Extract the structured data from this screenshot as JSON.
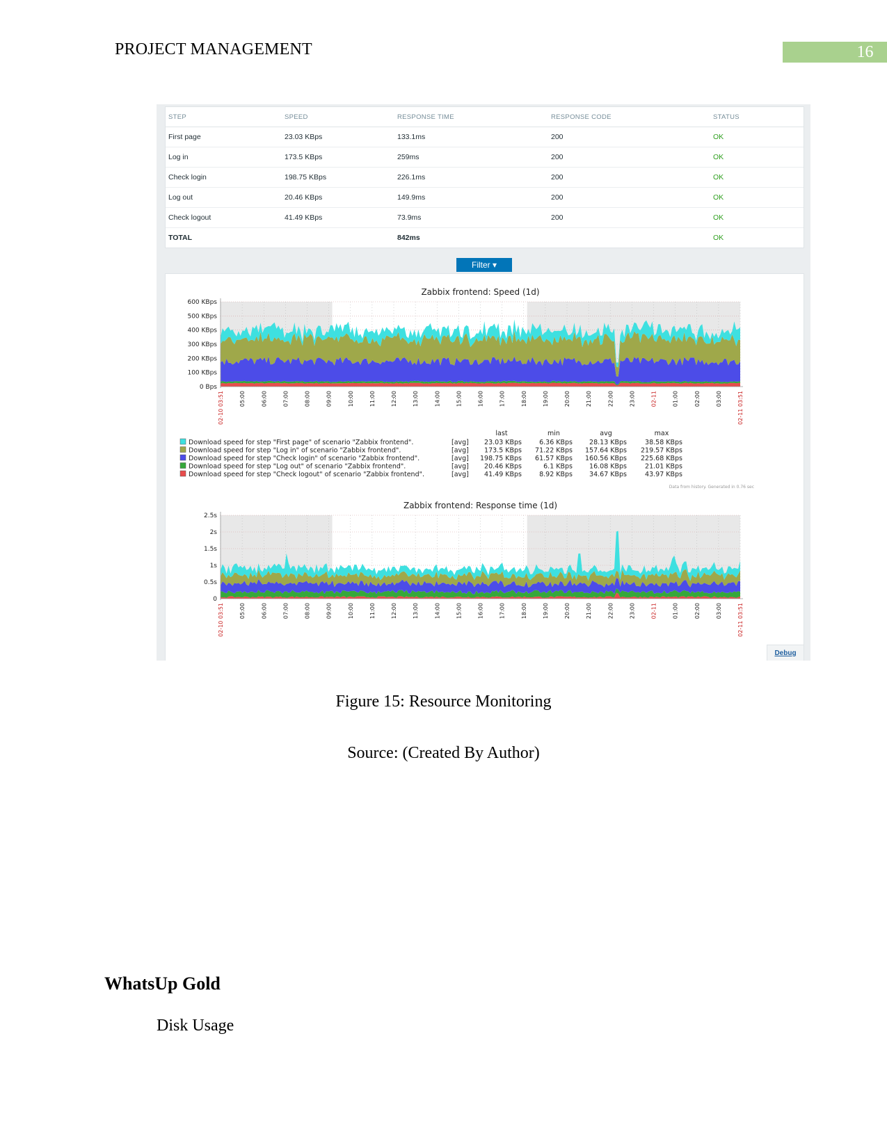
{
  "header": {
    "title": "PROJECT MANAGEMENT",
    "page_number": "16"
  },
  "table": {
    "columns": [
      "STEP",
      "SPEED",
      "RESPONSE TIME",
      "RESPONSE CODE",
      "STATUS"
    ],
    "rows": [
      [
        "First page",
        "23.03 KBps",
        "133.1ms",
        "200",
        "OK"
      ],
      [
        "Log in",
        "173.5 KBps",
        "259ms",
        "200",
        "OK"
      ],
      [
        "Check login",
        "198.75 KBps",
        "226.1ms",
        "200",
        "OK"
      ],
      [
        "Log out",
        "20.46 KBps",
        "149.9ms",
        "200",
        "OK"
      ],
      [
        "Check logout",
        "41.49 KBps",
        "73.9ms",
        "200",
        "OK"
      ]
    ],
    "total": [
      "TOTAL",
      "",
      "842ms",
      "",
      "OK"
    ]
  },
  "filter_label": "Filter ▾",
  "debug_label": "Debug",
  "colors": {
    "cyan": "#3ee0e0",
    "olive": "#9fa84a",
    "blue": "#4c4ce8",
    "green": "#35a83a",
    "red": "#e84c4c",
    "accent": "#0275b8",
    "header_bar": "#a9d18e"
  },
  "chart_data": [
    {
      "type": "area",
      "title": "Zabbix frontend: Speed (1d)",
      "y_ticks": [
        "600 KBps",
        "500 KBps",
        "400 KBps",
        "300 KBps",
        "200 KBps",
        "100 KBps",
        "0 Bps"
      ],
      "ylim": [
        0,
        600
      ],
      "x_ticks": [
        "02-10 03:51",
        "05:00",
        "06:00",
        "07:00",
        "08:00",
        "09:00",
        "10:00",
        "11:00",
        "12:00",
        "13:00",
        "14:00",
        "15:00",
        "16:00",
        "17:00",
        "18:00",
        "19:00",
        "20:00",
        "21:00",
        "22:00",
        "23:00",
        "02-11",
        "01:00",
        "02:00",
        "03:00",
        "02-11 03:51"
      ],
      "legend_headers": [
        "last",
        "min",
        "avg",
        "max"
      ],
      "series": [
        {
          "name": "Download speed for step \"First page\" of scenario \"Zabbix frontend\".",
          "func": "[avg]",
          "last": "23.03 KBps",
          "min": "6.36 KBps",
          "avg": "28.13 KBps",
          "max": "38.58 KBps"
        },
        {
          "name": "Download speed for step \"Log in\" of scenario \"Zabbix frontend\".",
          "func": "[avg]",
          "last": "173.5 KBps",
          "min": "71.22 KBps",
          "avg": "157.64 KBps",
          "max": "219.57 KBps"
        },
        {
          "name": "Download speed for step \"Check login\" of scenario \"Zabbix frontend\".",
          "func": "[avg]",
          "last": "198.75 KBps",
          "min": "61.57 KBps",
          "avg": "160.56 KBps",
          "max": "225.68 KBps"
        },
        {
          "name": "Download speed for step \"Log out\" of scenario \"Zabbix frontend\".",
          "func": "[avg]",
          "last": "20.46 KBps",
          "min": "6.1 KBps",
          "avg": "16.08 KBps",
          "max": "21.01 KBps"
        },
        {
          "name": "Download speed for step \"Check logout\" of scenario \"Zabbix frontend\".",
          "func": "[avg]",
          "last": "41.49 KBps",
          "min": "8.92 KBps",
          "avg": "34.67 KBps",
          "max": "43.97 KBps"
        }
      ],
      "note": "Data from history. Generated in 0.76 sec"
    },
    {
      "type": "area",
      "title": "Zabbix frontend: Response time (1d)",
      "y_ticks": [
        "2.5s",
        "2s",
        "1.5s",
        "1s",
        "0.5s",
        "0"
      ],
      "ylim": [
        0,
        2.5
      ],
      "x_ticks": [
        "02-10 03:51",
        "05:00",
        "06:00",
        "07:00",
        "08:00",
        "09:00",
        "10:00",
        "11:00",
        "12:00",
        "13:00",
        "14:00",
        "15:00",
        "16:00",
        "17:00",
        "18:00",
        "19:00",
        "20:00",
        "21:00",
        "22:00",
        "23:00",
        "02-11",
        "01:00",
        "02:00",
        "03:00",
        "02-11 03:51"
      ]
    }
  ],
  "caption": "Figure 15: Resource Monitoring",
  "source": "Source: (Created By Author)",
  "heading": "WhatsUp Gold",
  "subheading": "Disk Usage"
}
